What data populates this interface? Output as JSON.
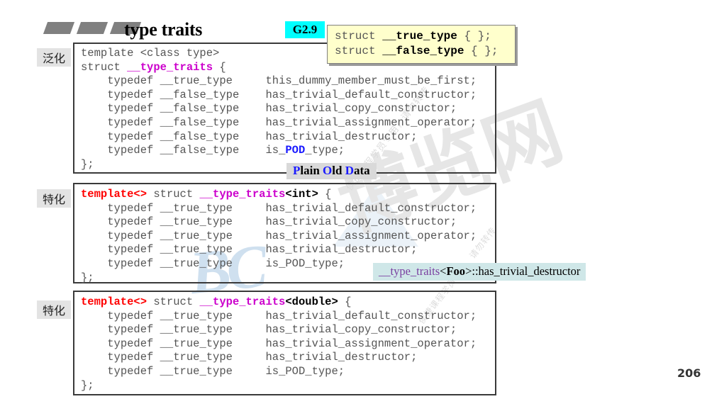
{
  "slide": {
    "title": "type traits",
    "badge": "G2.9",
    "page_number": "206",
    "accent_cyan": "#00ffff",
    "accent_magenta": "#cc00cc",
    "accent_red": "#ff0000",
    "accent_blue": "#1a1aff",
    "note_bg": "#cfe7e8",
    "callout_bg": "#ffffcc"
  },
  "callout": {
    "line1_pre": "struct ",
    "line1_name": "__true_type",
    "line1_post": " { };",
    "line2_pre": "struct ",
    "line2_name": "__false_type",
    "line2_post": " { };"
  },
  "tags": {
    "generalization": "泛化",
    "specialization_int": "特化",
    "specialization_double": "特化"
  },
  "block1": {
    "l1": "template <class type>",
    "l2_pre": "struct ",
    "l2_name": "__type_traits",
    "l2_post": " {",
    "rows": [
      {
        "typedef": "typedef __true_type",
        "member": "this_dummy_member_must_be_first;"
      },
      {
        "typedef": "typedef __false_type",
        "member": "has_trivial_default_constructor;"
      },
      {
        "typedef": "typedef __false_type",
        "member": "has_trivial_copy_constructor;"
      },
      {
        "typedef": "typedef __false_type",
        "member": "has_trivial_assignment_operator;"
      },
      {
        "typedef": "typedef __false_type",
        "member": "has_trivial_destructor;"
      }
    ],
    "pod_typedef": "typedef __false_type",
    "pod_pre": "is_",
    "pod_hl": "POD",
    "pod_post": "_type;",
    "close": "};"
  },
  "block2": {
    "h_tpl": "template<>",
    "h_mid": " struct ",
    "h_name": "__type_traits",
    "h_spec": "<int>",
    "h_post": " {",
    "rows": [
      {
        "typedef": "typedef __true_type",
        "member": "has_trivial_default_constructor;"
      },
      {
        "typedef": "typedef __true_type",
        "member": "has_trivial_copy_constructor;"
      },
      {
        "typedef": "typedef __true_type",
        "member": "has_trivial_assignment_operator;"
      },
      {
        "typedef": "typedef __true_type",
        "member": "has_trivial_destructor;"
      },
      {
        "typedef": "typedef __true_type",
        "member": "is_POD_type;"
      }
    ],
    "close": "};"
  },
  "block3": {
    "h_tpl": "template<>",
    "h_mid": " struct ",
    "h_name": "__type_traits",
    "h_spec": "<double>",
    "h_post": " {",
    "rows": [
      {
        "typedef": "typedef __true_type",
        "member": "has_trivial_default_constructor;"
      },
      {
        "typedef": "typedef __true_type",
        "member": "has_trivial_copy_constructor;"
      },
      {
        "typedef": "typedef __true_type",
        "member": "has_trivial_assignment_operator;"
      },
      {
        "typedef": "typedef __true_type",
        "member": "has_trivial_destructor;"
      },
      {
        "typedef": "typedef __true_type",
        "member": "is_POD_type;"
      }
    ],
    "close": "};"
  },
  "pod_label": {
    "p": "P",
    "lain": "lain ",
    "o": "O",
    "ld": "ld ",
    "d": "D",
    "ata": "ata"
  },
  "cyan_note": {
    "name": "__type_traits",
    "lt": "<",
    "foo": "Foo",
    "gt": ">",
    "member": "::has_trivial_destructor"
  },
  "watermarks": {
    "bc": "BC",
    "cn": "博览网",
    "small": "侯捷课程学员专用，请勿转传",
    "small2": "侯捷课程学员专用，请勿转传"
  }
}
